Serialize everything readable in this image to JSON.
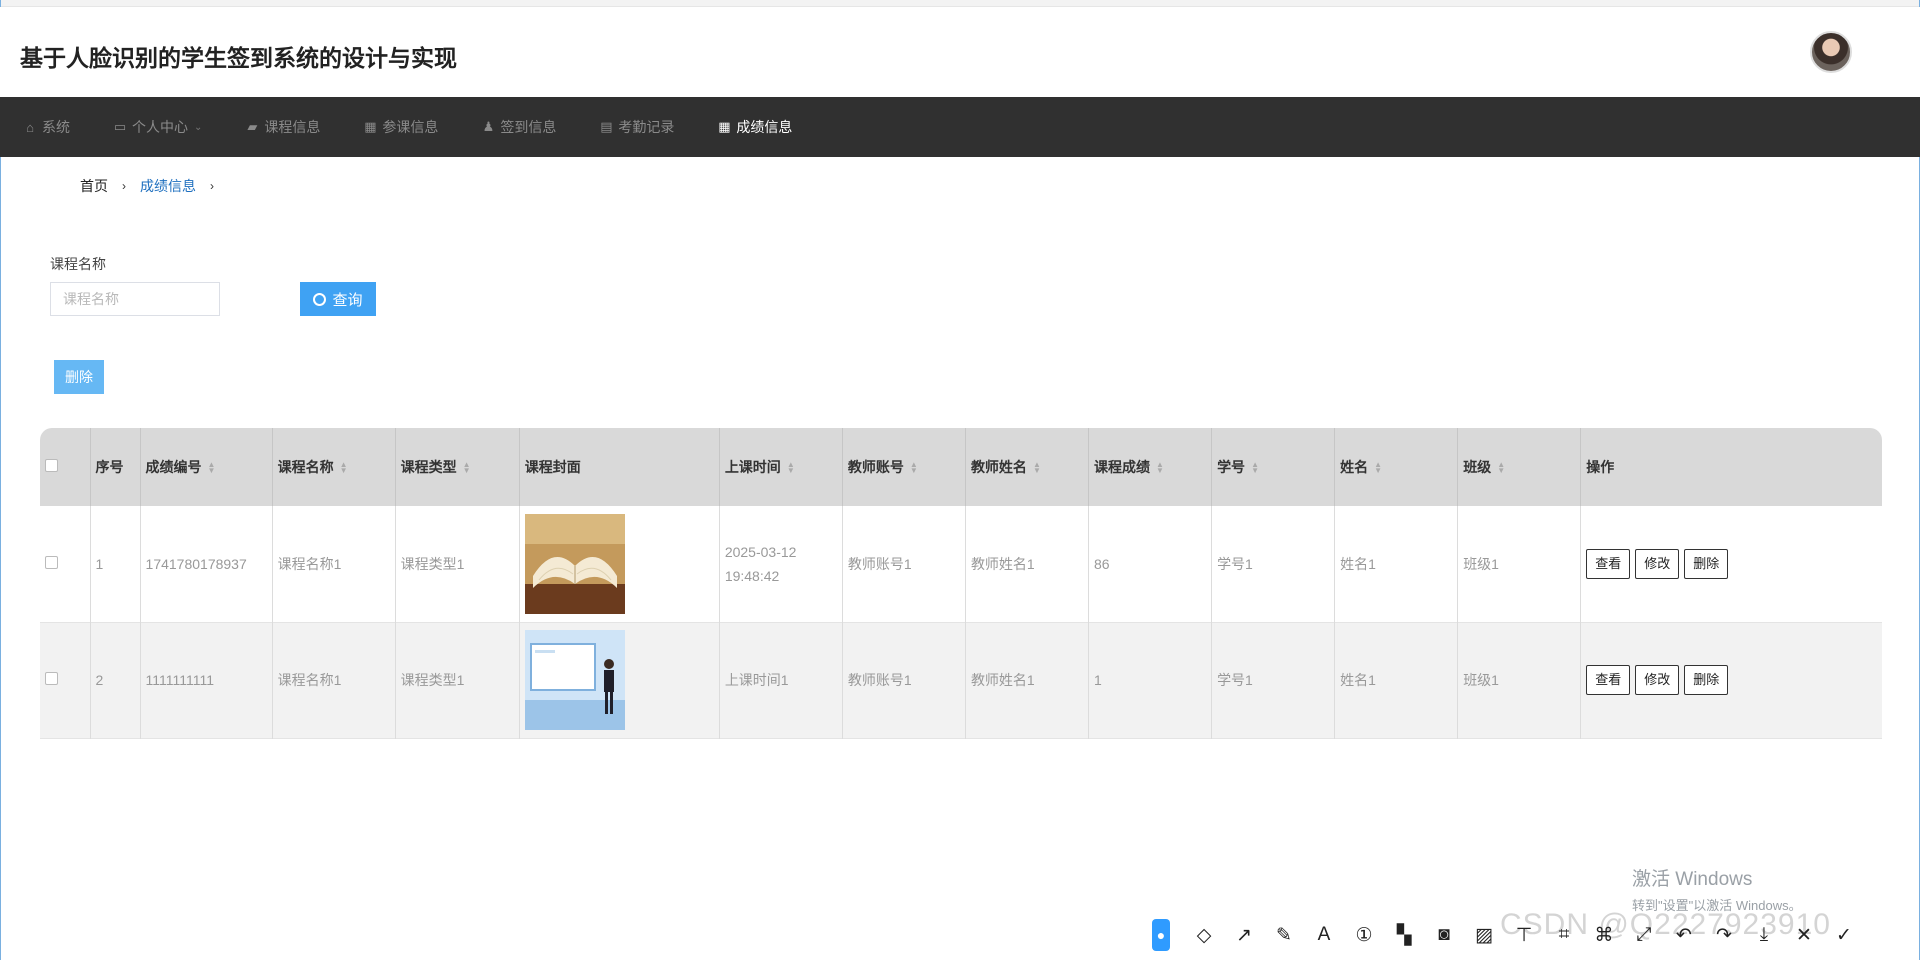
{
  "header": {
    "title": "基于人脸识别的学生签到系统的设计与实现"
  },
  "nav": {
    "items": [
      {
        "label": "系统",
        "icon": "home-icon",
        "glyph": "⌂"
      },
      {
        "label": "个人中心",
        "icon": "user-card-icon",
        "glyph": "▭",
        "caret": "⌄"
      },
      {
        "label": "课程信息",
        "icon": "briefcase-icon",
        "glyph": "▰"
      },
      {
        "label": "参课信息",
        "icon": "grid-icon",
        "glyph": "▦"
      },
      {
        "label": "签到信息",
        "icon": "person-icon",
        "glyph": "♟"
      },
      {
        "label": "考勤记录",
        "icon": "printer-icon",
        "glyph": "▤"
      },
      {
        "label": "成绩信息",
        "icon": "grid-icon",
        "glyph": "▦",
        "active": true
      }
    ]
  },
  "breadcrumb": {
    "home": "首页",
    "current": "成绩信息",
    "sep": "›"
  },
  "search": {
    "label": "课程名称",
    "placeholder": "课程名称",
    "query_label": "查询"
  },
  "actions": {
    "delete_label": "删除"
  },
  "table": {
    "headers": [
      "",
      "序号",
      "成绩编号",
      "课程名称",
      "课程类型",
      "课程封面",
      "上课时间",
      "教师账号",
      "教师姓名",
      "课程成绩",
      "学号",
      "姓名",
      "班级",
      "操作"
    ],
    "sortable": [
      false,
      false,
      true,
      true,
      true,
      false,
      true,
      true,
      true,
      true,
      true,
      true,
      true,
      false
    ],
    "rows": [
      {
        "index": "1",
        "code": "1741780178937",
        "course_name": "课程名称1",
        "course_type": "课程类型1",
        "cover": "book",
        "time": "2025-03-12 19:48:42",
        "teacher_account": "教师账号1",
        "teacher_name": "教师姓名1",
        "score": "86",
        "student_no": "学号1",
        "name": "姓名1",
        "class": "班级1"
      },
      {
        "index": "2",
        "code": "1111111111",
        "course_name": "课程名称1",
        "course_type": "课程类型1",
        "cover": "presenter",
        "time": "上课时间1",
        "teacher_account": "教师账号1",
        "teacher_name": "教师姓名1",
        "score": "1",
        "student_no": "学号1",
        "name": "姓名1",
        "class": "班级1"
      }
    ],
    "row_actions": {
      "view": "查看",
      "edit": "修改",
      "delete": "删除"
    }
  },
  "watermark": {
    "line1": "激活 Windows",
    "line2": "转到\"设置\"以激活 Windows。"
  },
  "csdn_mark": "CSDN @Q2227923910",
  "colors": {
    "nav_bg": "#303030",
    "primary": "#3fa2f3",
    "header_row": "#d9d9d9"
  }
}
